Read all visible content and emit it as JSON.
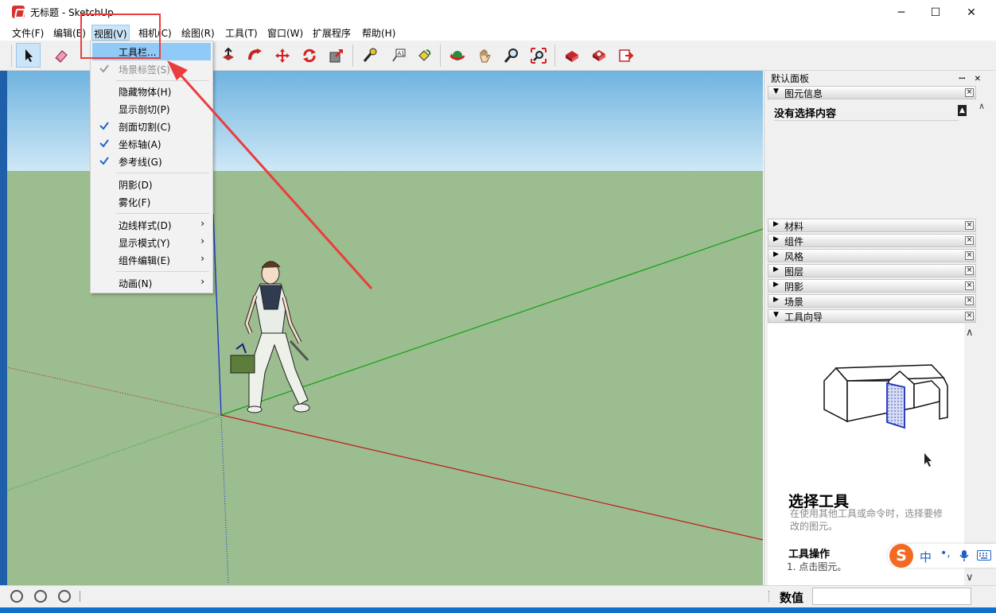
{
  "window": {
    "title": "无标题 - SketchUp",
    "minimize": "─",
    "maximize": "☐",
    "close": "✕"
  },
  "menubar": [
    {
      "label": "文件(F)"
    },
    {
      "label": "编辑(E)"
    },
    {
      "label": "视图(V)"
    },
    {
      "label": "相机(C)"
    },
    {
      "label": "绘图(R)"
    },
    {
      "label": "工具(T)"
    },
    {
      "label": "窗口(W)"
    },
    {
      "label": "扩展程序"
    },
    {
      "label": "帮助(H)"
    }
  ],
  "view_menu": {
    "items": [
      {
        "label": "工具栏...",
        "checked": false,
        "highlighted": true
      },
      {
        "label": "场景标签(S)",
        "checked": true,
        "disabled": true
      },
      {
        "label": "隐藏物体(H)",
        "checked": false
      },
      {
        "label": "显示剖切(P)",
        "checked": false
      },
      {
        "label": "剖面切割(C)",
        "checked": true
      },
      {
        "label": "坐标轴(A)",
        "checked": true
      },
      {
        "label": "参考线(G)",
        "checked": true
      },
      {
        "label": "阴影(D)",
        "checked": false
      },
      {
        "label": "雾化(F)",
        "checked": false
      },
      {
        "label": "边线样式(D)",
        "submenu": true
      },
      {
        "label": "显示模式(Y)",
        "submenu": true
      },
      {
        "label": "组件编辑(E)",
        "submenu": true
      },
      {
        "label": "动画(N)",
        "submenu": true
      }
    ],
    "submenu_arrow": "›"
  },
  "tray": {
    "title": "默认面板",
    "pin": "ꟷ",
    "close": "✕",
    "entity_info": {
      "label": "图元信息",
      "status": "没有选择内容"
    },
    "sections": [
      {
        "label": "材料"
      },
      {
        "label": "组件"
      },
      {
        "label": "风格"
      },
      {
        "label": "图层"
      },
      {
        "label": "阴影"
      },
      {
        "label": "场景"
      }
    ],
    "instructor": {
      "label": "工具向导",
      "title": "选择工具",
      "description": "在使用其他工具或命令时，选择要修改的图元。",
      "ops_heading": "工具操作",
      "step": "1.    点击图元。"
    }
  },
  "ime": {
    "logo": "S",
    "mode": "中",
    "punct": "•,"
  },
  "statusbar": {
    "measurements_label": "数值",
    "measurements_value": ""
  },
  "icons": {
    "toolbar": [
      "select-icon",
      "eraser-icon",
      "paint-icon",
      "pushpull-icon",
      "followme-icon",
      "move-icon",
      "rotate-icon",
      "scale-icon",
      "tape-icon",
      "text-icon",
      "paint-bucket-icon",
      "orbit-icon",
      "pan-icon",
      "zoom-icon",
      "zoom-extents-icon",
      "warehouse-icon",
      "components-icon",
      "send-layout-icon"
    ]
  },
  "colors": {
    "sky": "#6fb3e0",
    "ground": "#9bbd8f",
    "annotation": "#ea3d3d",
    "highlight": "#91c9f7"
  }
}
